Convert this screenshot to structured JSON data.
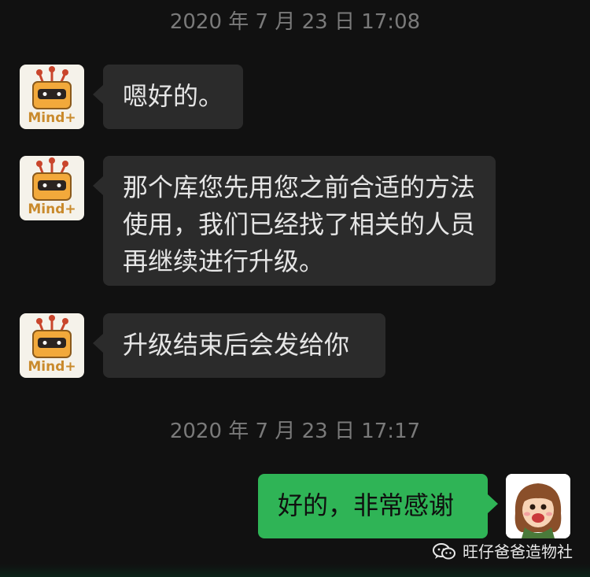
{
  "colors": {
    "background": "#111111",
    "incoming_bubble": "#2b2b2b",
    "outgoing_bubble": "#2fb456",
    "timestamp_text": "#7a7a7a"
  },
  "timestamps": [
    "2020 年 7 月 23 日 17:08",
    "2020 年 7 月 23 日 17:17"
  ],
  "messages": [
    {
      "sender": "bot",
      "text": "嗯好的。"
    },
    {
      "sender": "bot",
      "text": "那个库您先用您之前合适的方法使用，我们已经找了相关的人员再继续进行升级。"
    },
    {
      "sender": "bot",
      "text": "升级结束后会发给你"
    },
    {
      "sender": "me",
      "text": "好的，非常感谢"
    }
  ],
  "avatar_bot": {
    "label": "Mind+",
    "icon": "mind-plus-robot-icon"
  },
  "avatar_me": {
    "icon": "cartoon-girl-avatar-icon"
  },
  "watermark": {
    "icon": "wechat-icon",
    "text": "旺仔爸爸造物社"
  }
}
